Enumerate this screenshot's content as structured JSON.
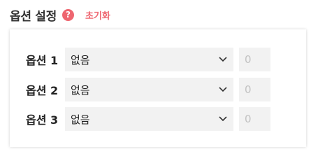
{
  "header": {
    "title": "옵션 설정",
    "help_icon": "question-circle-icon",
    "help_glyph": "?",
    "reset_label": "초기화"
  },
  "options": [
    {
      "label": "옵션 1",
      "selected": "없음",
      "quantity_placeholder": "0"
    },
    {
      "label": "옵션 2",
      "selected": "없음",
      "quantity_placeholder": "0"
    },
    {
      "label": "옵션 3",
      "selected": "없음",
      "quantity_placeholder": "0"
    }
  ],
  "colors": {
    "accent": "#ee6670",
    "field_bg": "#f2f2f2",
    "text": "#222222"
  }
}
